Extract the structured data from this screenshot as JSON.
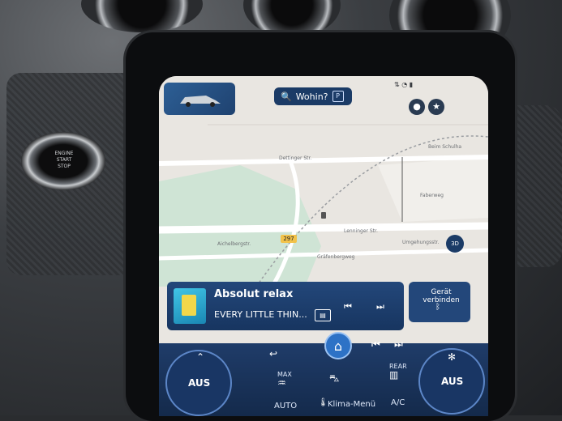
{
  "physical": {
    "start_button": [
      "ENGINE",
      "START",
      "STOP"
    ]
  },
  "map": {
    "streets": [
      "Dettinger Str.",
      "Lenninger Str.",
      "Gräfenbergweg",
      "Aichelbergstr.",
      "Umgehungsstr.",
      "Faberweg",
      "Beim Schulha"
    ],
    "road_number": "297",
    "view_3d_label": "3D"
  },
  "header": {
    "search_label": "Wohin?",
    "parking_badge": "P",
    "profile_icon": "person-icon",
    "favorite_icon": "star-icon"
  },
  "media": {
    "title": "Absolut relax",
    "artist": "EVERY LITTLE THIN...",
    "prev_icon": "skip-back-icon",
    "next_icon": "skip-forward-icon",
    "device_label": "Gerät verbinden",
    "bt_icon": "bluetooth-icon"
  },
  "climate": {
    "left_dial": "AUS",
    "right_dial": "AUS",
    "max_label": "MAX",
    "rear_label": "REAR",
    "auto_label": "AUTO",
    "menu_label": "Klima-Menü",
    "ac_label": "A/C"
  },
  "colors": {
    "accent": "#2d72c6",
    "panel": "#1f3c69",
    "map_bg": "#e9e6e1",
    "map_green": "#cfe4d5"
  }
}
